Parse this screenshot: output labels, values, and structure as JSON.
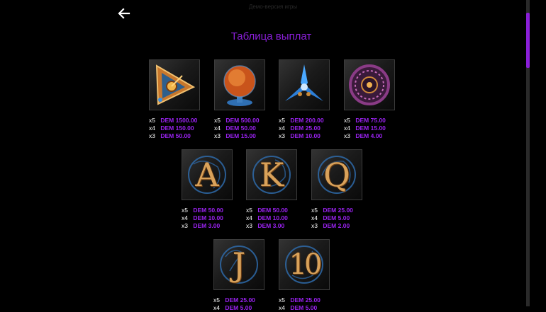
{
  "header": {
    "back_icon": "arrow-left-icon",
    "top_note": "Демо-версия игры",
    "title": "Таблица выплат"
  },
  "colors": {
    "accent": "#8a1fd8",
    "payout": "#9a22f0",
    "letter_gold": "#d9a25a",
    "tile_blue": "#2f6fb3"
  },
  "symbols": [
    {
      "name": "golden-triangle",
      "icon": "triangle-gem-icon",
      "pays": [
        {
          "k": "x5",
          "v": "DEM 1500.00"
        },
        {
          "k": "x4",
          "v": "DEM 150.00"
        },
        {
          "k": "x3",
          "v": "DEM 50.00"
        }
      ]
    },
    {
      "name": "sun-globe",
      "icon": "sun-globe-icon",
      "pays": [
        {
          "k": "x5",
          "v": "DEM 500.00"
        },
        {
          "k": "x4",
          "v": "DEM 50.00"
        },
        {
          "k": "x3",
          "v": "DEM 15.00"
        }
      ]
    },
    {
      "name": "blue-star",
      "icon": "blue-star-icon",
      "pays": [
        {
          "k": "x5",
          "v": "DEM 200.00"
        },
        {
          "k": "x4",
          "v": "DEM 25.00"
        },
        {
          "k": "x3",
          "v": "DEM 10.00"
        }
      ]
    },
    {
      "name": "astrolabe",
      "icon": "astrolabe-icon",
      "pays": [
        {
          "k": "x5",
          "v": "DEM 75.00"
        },
        {
          "k": "x4",
          "v": "DEM 15.00"
        },
        {
          "k": "x3",
          "v": "DEM 4.00"
        }
      ]
    },
    {
      "name": "letter-a",
      "letter": "A",
      "icon": "letter-a-icon",
      "pays": [
        {
          "k": "x5",
          "v": "DEM 50.00"
        },
        {
          "k": "x4",
          "v": "DEM 10.00"
        },
        {
          "k": "x3",
          "v": "DEM 3.00"
        }
      ]
    },
    {
      "name": "letter-k",
      "letter": "K",
      "icon": "letter-k-icon",
      "pays": [
        {
          "k": "x5",
          "v": "DEM 50.00"
        },
        {
          "k": "x4",
          "v": "DEM 10.00"
        },
        {
          "k": "x3",
          "v": "DEM 3.00"
        }
      ]
    },
    {
      "name": "letter-q",
      "letter": "Q",
      "icon": "letter-q-icon",
      "pays": [
        {
          "k": "x5",
          "v": "DEM 25.00"
        },
        {
          "k": "x4",
          "v": "DEM 5.00"
        },
        {
          "k": "x3",
          "v": "DEM 2.00"
        }
      ]
    },
    {
      "name": "letter-j",
      "letter": "J",
      "icon": "letter-j-icon",
      "pays": [
        {
          "k": "x5",
          "v": "DEM 25.00"
        },
        {
          "k": "x4",
          "v": "DEM 5.00"
        }
      ]
    },
    {
      "name": "number-10",
      "letter": "10",
      "icon": "number-10-icon",
      "pays": [
        {
          "k": "x5",
          "v": "DEM 25.00"
        },
        {
          "k": "x4",
          "v": "DEM 5.00"
        }
      ]
    }
  ]
}
